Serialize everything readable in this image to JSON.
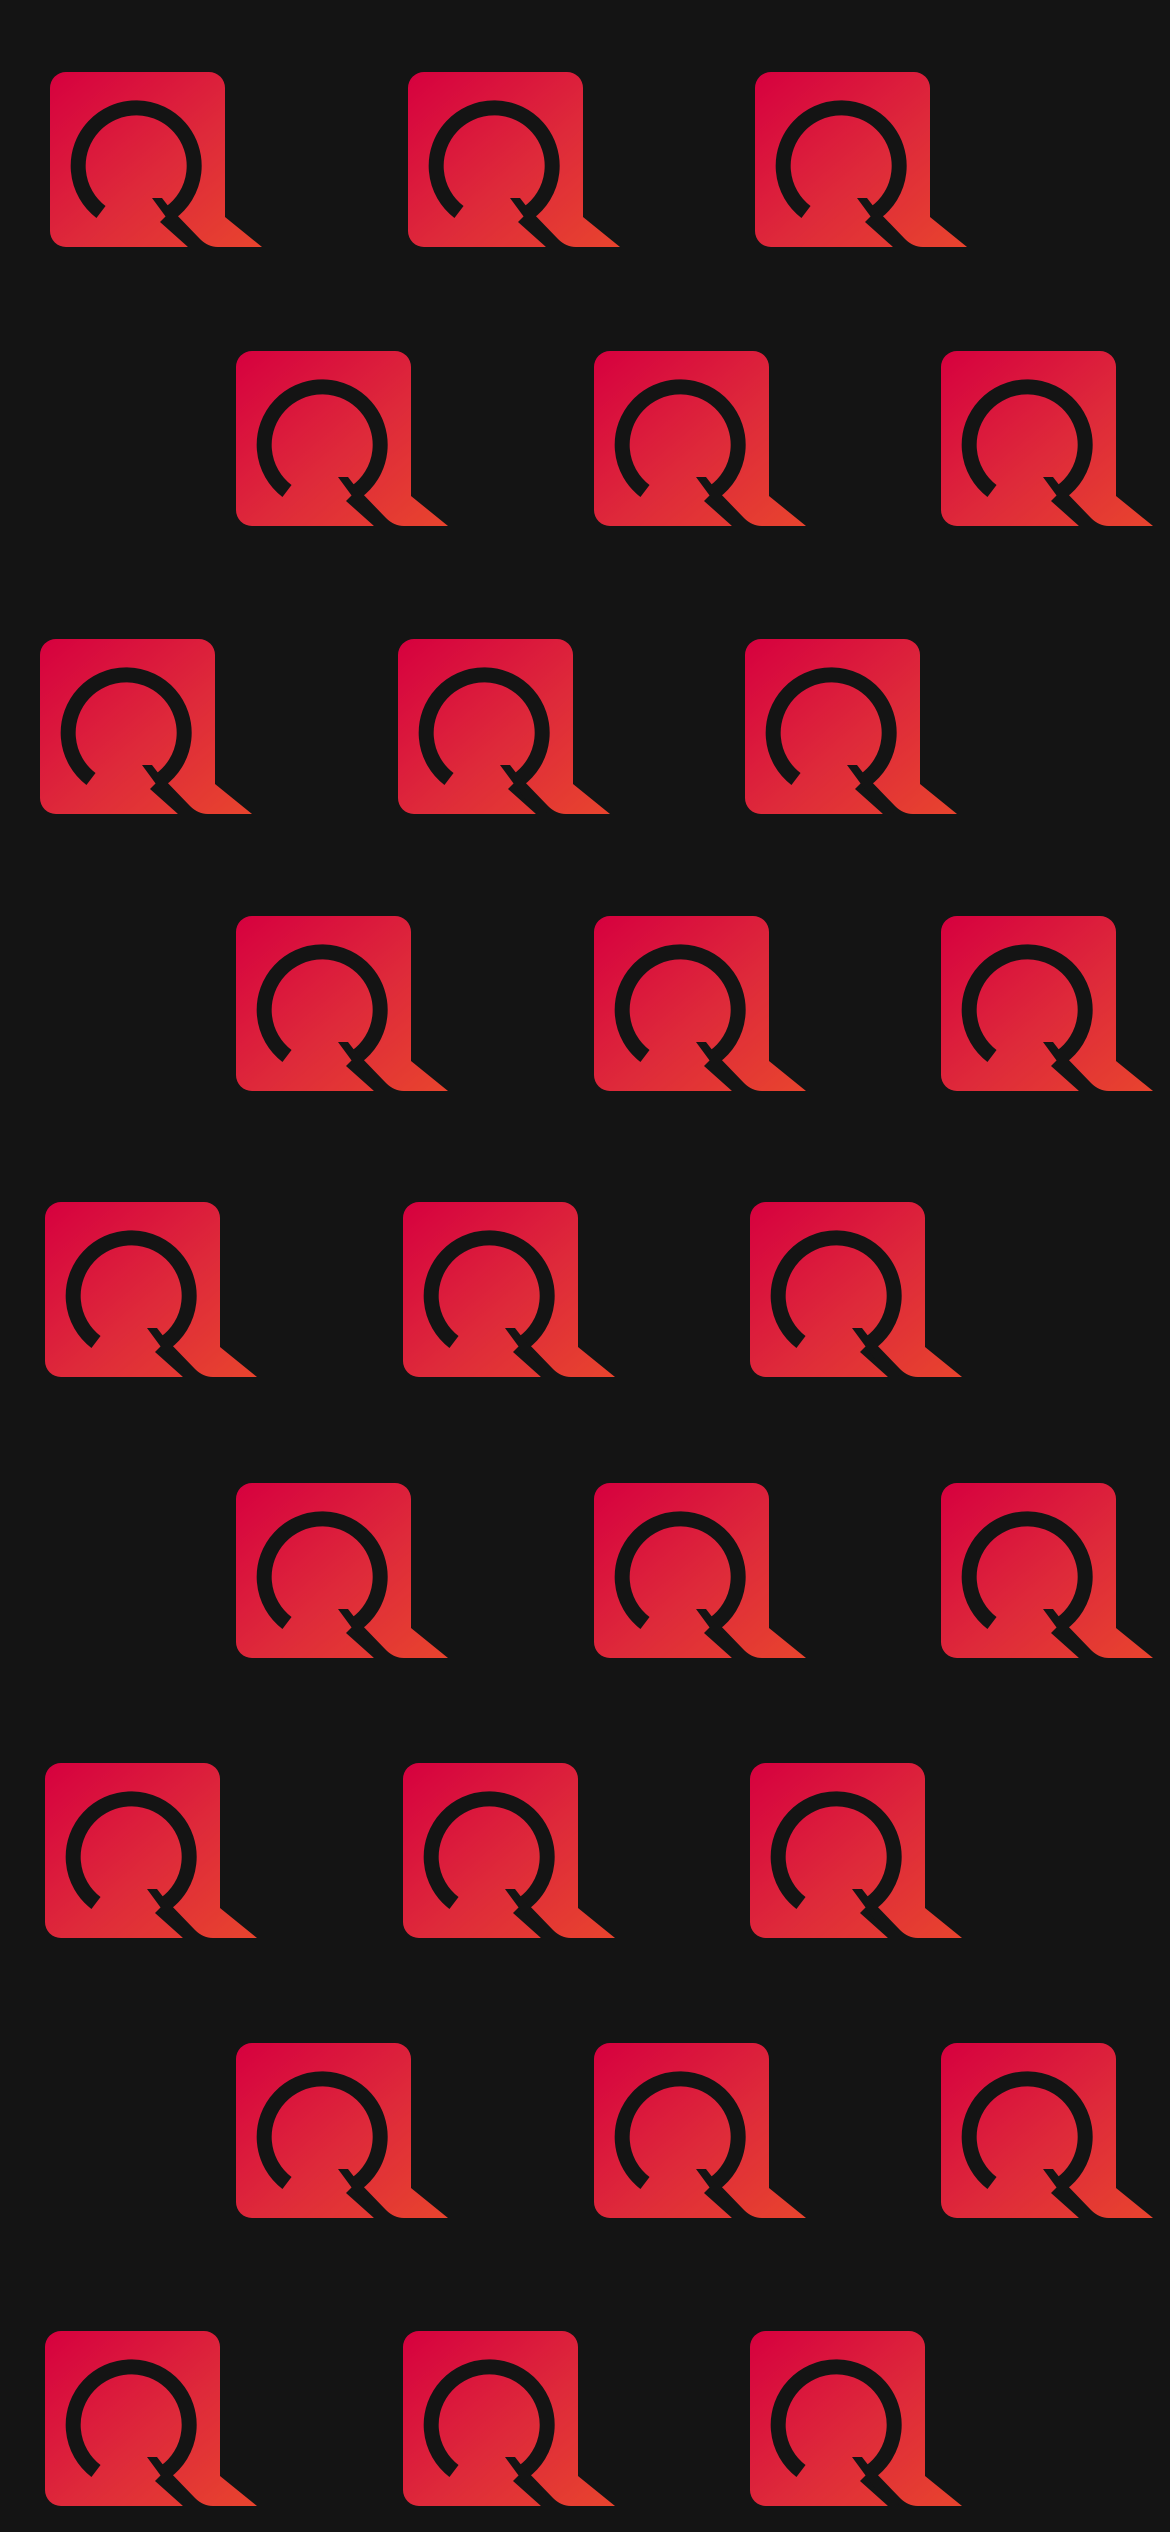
{
  "background_color": "#141414",
  "logo": {
    "icon": "q-logo-icon",
    "gradient_start": "#D6003F",
    "gradient_mid": "#DE2A3A",
    "gradient_end": "#E8442E",
    "ring_color": "#141414"
  },
  "pattern": {
    "rows": 9,
    "logos_per_row": 3,
    "total_logos": 27,
    "layout": "staggered-alternating-rows"
  }
}
